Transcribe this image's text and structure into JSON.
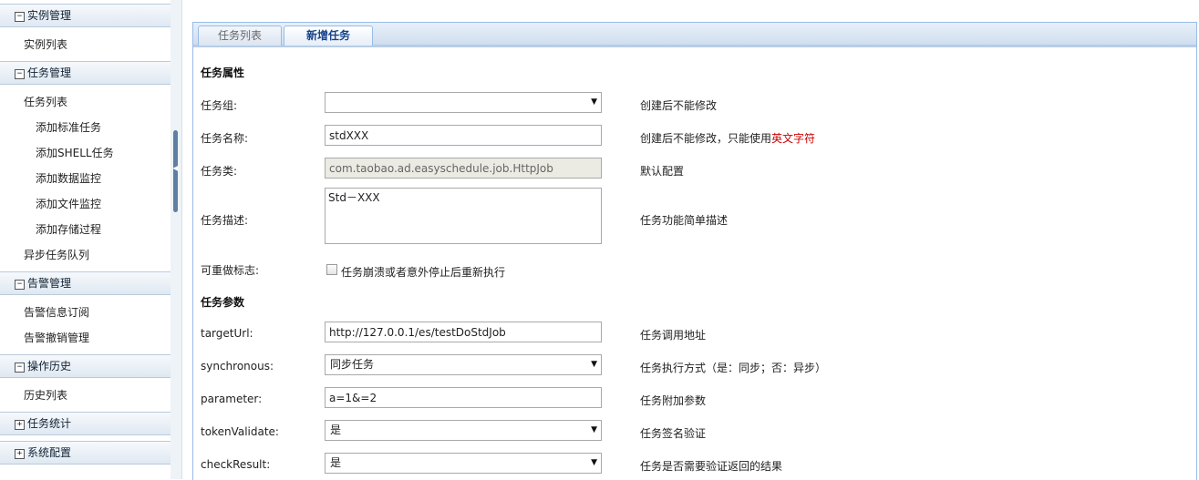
{
  "sidebar": {
    "groups": [
      {
        "label": "实例管理",
        "toggle": "⊟",
        "items": [
          {
            "label": "实例列表",
            "sub": false
          }
        ]
      },
      {
        "label": "任务管理",
        "toggle": "⊟",
        "items": [
          {
            "label": "任务列表",
            "sub": false
          },
          {
            "label": "添加标准任务",
            "sub": true
          },
          {
            "label": "添加SHELL任务",
            "sub": true
          },
          {
            "label": "添加数据监控",
            "sub": true
          },
          {
            "label": "添加文件监控",
            "sub": true
          },
          {
            "label": "添加存储过程",
            "sub": true
          },
          {
            "label": "异步任务队列",
            "sub": false
          }
        ]
      },
      {
        "label": "告警管理",
        "toggle": "⊟",
        "items": [
          {
            "label": "告警信息订阅",
            "sub": false
          },
          {
            "label": "告警撤销管理",
            "sub": false
          }
        ]
      },
      {
        "label": "操作历史",
        "toggle": "⊟",
        "items": [
          {
            "label": "历史列表",
            "sub": false
          }
        ]
      },
      {
        "label": "任务统计",
        "toggle": "⊞",
        "items": []
      },
      {
        "label": "系统配置",
        "toggle": "⊞",
        "items": []
      }
    ]
  },
  "tabs": {
    "list": "任务列表",
    "new": "新增任务"
  },
  "form": {
    "section_attributes": "任务属性",
    "section_params": "任务参数",
    "group": {
      "label": "任务组:",
      "value": "",
      "hint": "创建后不能修改"
    },
    "name": {
      "label": "任务名称:",
      "value": "stdXXX",
      "hint_prefix": "创建后不能修改，只能使用",
      "hint_red": "英文字符"
    },
    "class": {
      "label": "任务类:",
      "value": "com.taobao.ad.easyschedule.job.HttpJob",
      "hint": "默认配置"
    },
    "desc": {
      "label": "任务描述:",
      "value": "Std－XXX",
      "hint": "任务功能简单描述"
    },
    "redo": {
      "label": "可重做标志:",
      "checkbox_label": "任务崩溃或者意外停止后重新执行",
      "checked": false
    },
    "target_url": {
      "label": "targetUrl:",
      "value": "http://127.0.0.1/es/testDoStdJob",
      "hint": "任务调用地址"
    },
    "synchronous": {
      "label": "synchronous:",
      "value": "同步任务",
      "hint": "任务执行方式（是：同步；否：异步）"
    },
    "parameter": {
      "label": "parameter:",
      "value": "a=1&=2",
      "hint": "任务附加参数"
    },
    "token_validate": {
      "label": "tokenValidate:",
      "value": "是",
      "hint": "任务签名验证"
    },
    "check_result": {
      "label": "checkResult:",
      "value": "是",
      "hint": "任务是否需要验证返回的结果"
    }
  },
  "icons": {
    "expanded": "minus-box-icon",
    "collapsed": "plus-box-icon",
    "dropdown": "triangle-down-icon",
    "splitter": "collapse-left-icon"
  },
  "colors": {
    "header_gradient_top": "#f6f9fc",
    "header_gradient_bottom": "#dfe8f2",
    "tab_border": "#99bbe8",
    "active_tab_text": "#15428b",
    "hint_red": "#cc0000"
  }
}
